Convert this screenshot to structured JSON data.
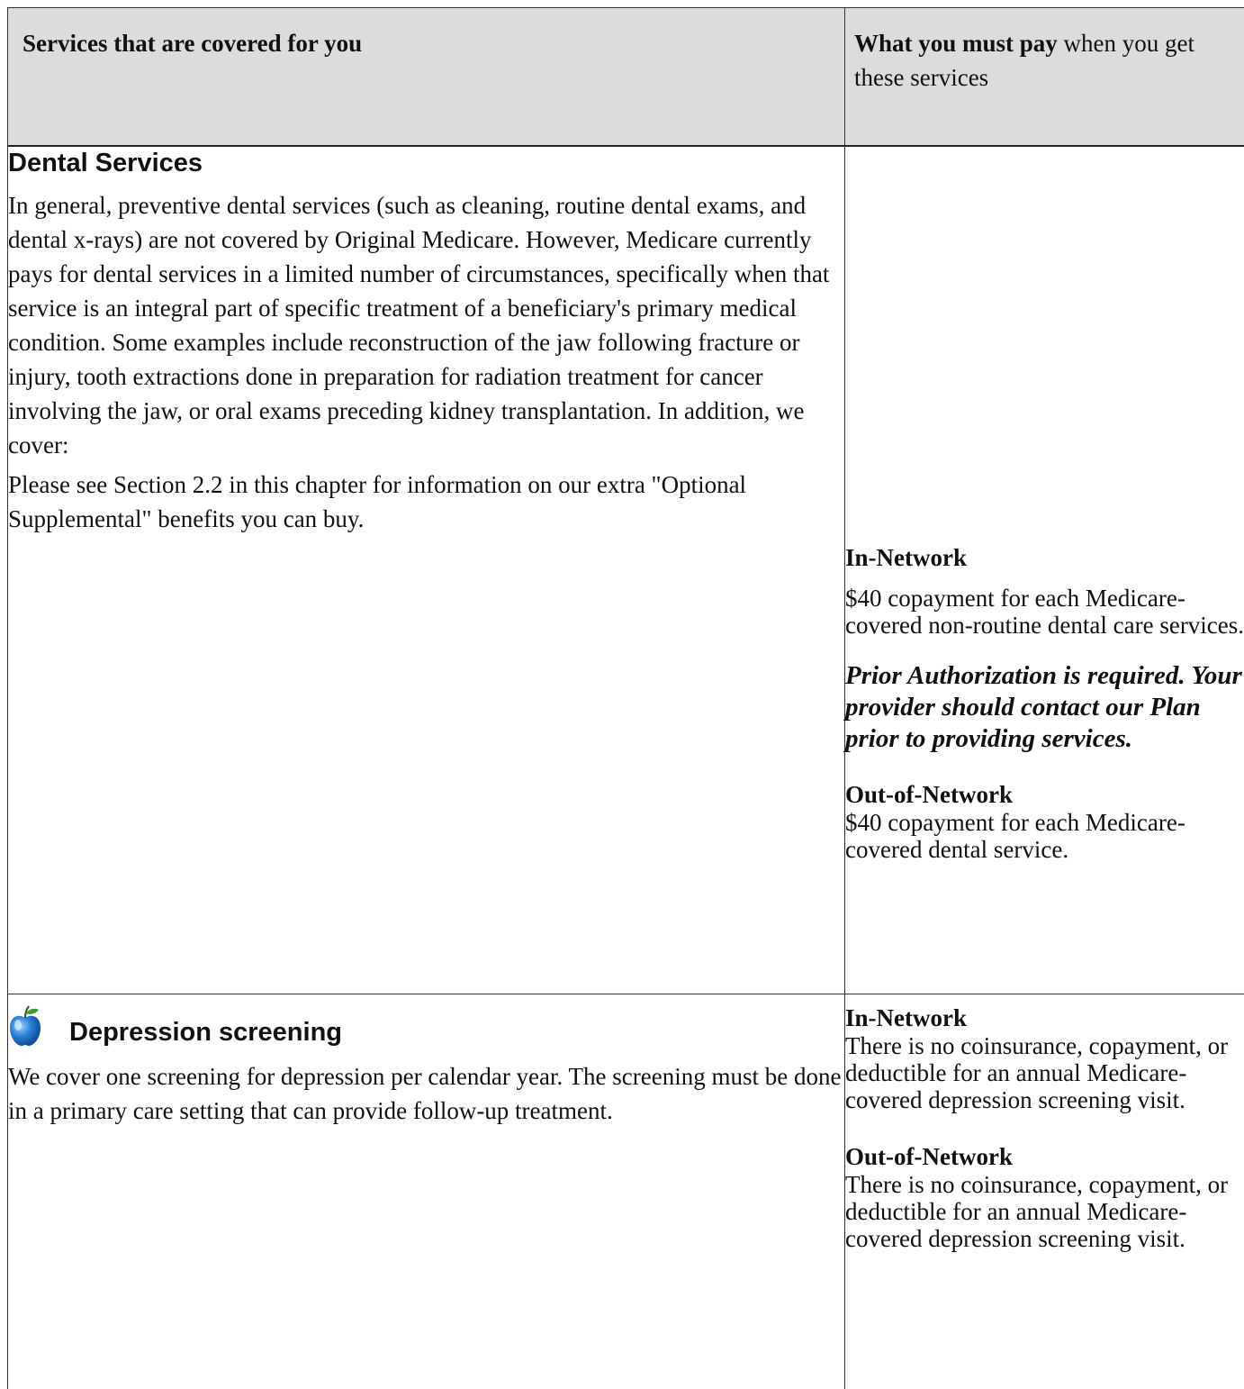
{
  "header": {
    "services_label": "Services that are covered for you",
    "pay_bold": "What you must pay",
    "pay_rest": " when you get these services"
  },
  "dental": {
    "title": "Dental Services",
    "para1": "In general, preventive dental services (such as cleaning, routine dental exams, and dental x-rays) are not covered by Original Medicare. However, Medicare currently pays for dental services in a limited number of circumstances, specifically when that service is an integral part of specific treatment of a beneficiary's primary medical condition. Some examples include reconstruction of the jaw following fracture or injury, tooth extractions done in preparation for radiation treatment for cancer involving the jaw, or oral exams preceding kidney transplantation. In addition, we cover:",
    "para2": "Please see Section 2.2 in this chapter for information on our extra \"Optional Supplemental\" benefits you can buy.",
    "pay": {
      "in_network_label": "In-Network",
      "in_network_text": "$40 copayment for each Medicare-covered non-routine dental care services.",
      "prior_auth": "Prior Authorization is required. Your provider should contact our Plan prior to providing services.",
      "out_network_label": "Out-of-Network",
      "out_network_text": "$40 copayment for each Medicare-covered dental service."
    }
  },
  "depression": {
    "icon": "apple-icon",
    "title": "Depression screening",
    "para": "We cover one screening for depression per calendar year. The screening must be done in a primary care setting that can provide follow-up treatment.",
    "pay": {
      "in_network_label": "In-Network",
      "in_network_text": "There is no coinsurance, copayment, or deductible for an annual Medicare-covered depression screening visit.",
      "out_network_label": "Out-of-Network",
      "out_network_text": "There is no coinsurance, copayment, or deductible for an annual Medicare-covered depression screening visit."
    }
  }
}
